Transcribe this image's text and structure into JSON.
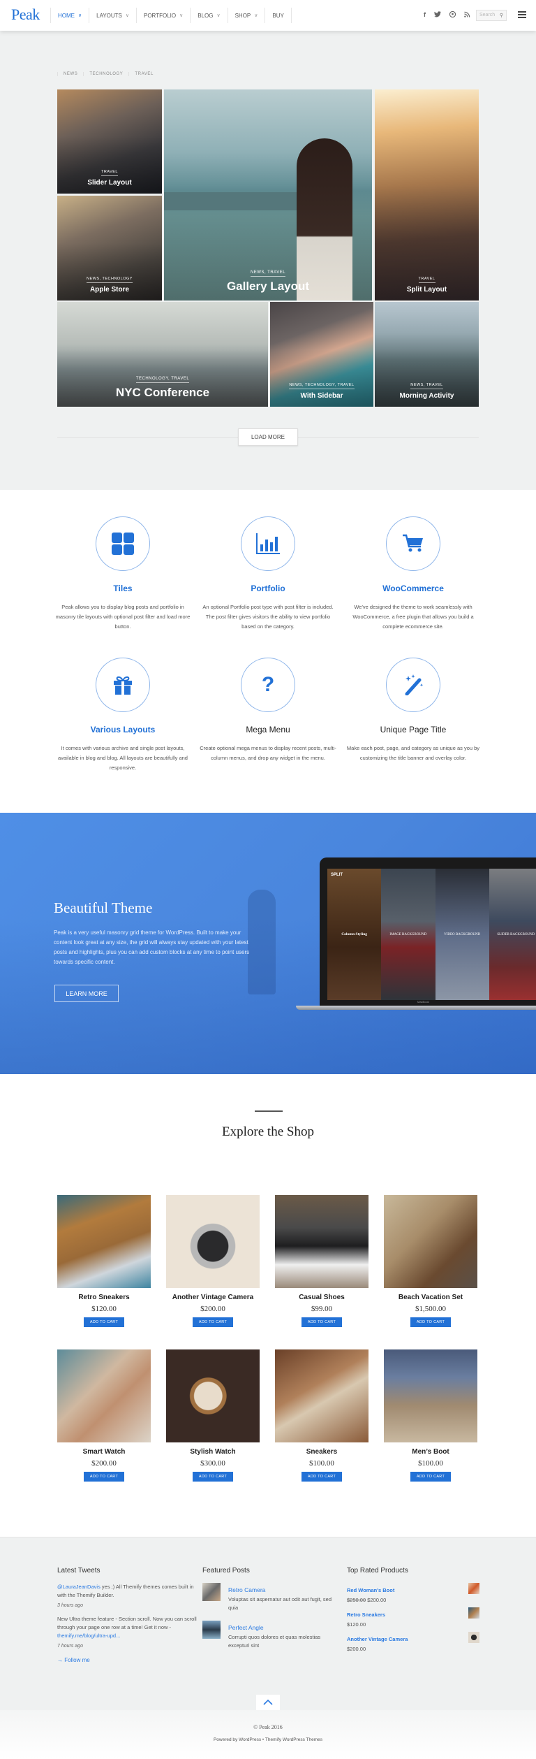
{
  "header": {
    "logo": "Peak",
    "nav": [
      {
        "label": "HOME",
        "dropdown": true,
        "active": true
      },
      {
        "label": "LAYOUTS",
        "dropdown": true
      },
      {
        "label": "PORTFOLIO",
        "dropdown": true
      },
      {
        "label": "BLOG",
        "dropdown": true
      },
      {
        "label": "SHOP",
        "dropdown": true
      },
      {
        "label": "BUY",
        "dropdown": false
      }
    ],
    "social": [
      "facebook-icon",
      "twitter-icon",
      "pinterest-icon",
      "rss-icon"
    ],
    "search_placeholder": "Search"
  },
  "filter": [
    "NEWS",
    "TECHNOLOGY",
    "TRAVEL"
  ],
  "tiles": [
    {
      "category": "TRAVEL",
      "title": "Slider Layout"
    },
    {
      "category": "NEWS, TRAVEL",
      "title": "Gallery Layout"
    },
    {
      "category": "TRAVEL",
      "title": "Split Layout"
    },
    {
      "category": "NEWS, TECHNOLOGY",
      "title": "Apple Store"
    },
    {
      "category": "TECHNOLOGY, TRAVEL",
      "title": "NYC Conference"
    },
    {
      "category": "NEWS, TECHNOLOGY, TRAVEL",
      "title": "With Sidebar"
    },
    {
      "category": "NEWS, TRAVEL",
      "title": "Morning Activity"
    }
  ],
  "load_more": "LOAD MORE",
  "features": [
    {
      "icon": "tiles-icon",
      "title": "Tiles",
      "text": "Peak allows you to display blog posts and portfolio in masonry tile layouts with optional post filter and load more button."
    },
    {
      "icon": "bar-chart-icon",
      "title": "Portfolio",
      "text": "An optional Portfolio post type with post filter is included. The post filter gives visitors the ability to view portfolio based on the category."
    },
    {
      "icon": "cart-icon",
      "title": "WooCommerce",
      "text": "We've designed the theme to work seamlessly with WooCommerce, a free plugin that allows you build a complete ecommerce site."
    },
    {
      "icon": "gift-icon",
      "title": "Various Layouts",
      "text": "It comes with various archive and single post layouts, available in blog and blog. All layouts are beautifully and responsive."
    },
    {
      "icon": "question-icon",
      "title": "Mega Menu",
      "text": "Create optional mega menus to display recent posts, multi-column menus, and drop any widget in the menu."
    },
    {
      "icon": "magic-wand-icon",
      "title": "Unique Page Title",
      "text": "Make each post, page, and category as unique as you by customizing the title banner and overlay color."
    }
  ],
  "hero": {
    "title": "Beautiful Theme",
    "text": "Peak is a very useful masonry grid theme for WordPress. Built to make your content look great at any size, the grid will always stay updated with your latest posts and highlights, plus you can add custom blocks at any time to point users towards specific content.",
    "button": "LEARN MORE",
    "laptop": {
      "logo": "SPLIT",
      "panels": [
        "Column Styling",
        "IMAGE BACKGROUND",
        "VIDEO BACKGROUND",
        "SLIDER BACKGROUND"
      ],
      "brand": "MacBook"
    }
  },
  "shop": {
    "title": "Explore the Shop",
    "add_to_cart": "ADD TO CART",
    "products": [
      {
        "name": "Retro Sneakers",
        "price": "$120.00"
      },
      {
        "name": "Another Vintage Camera",
        "price": "$200.00"
      },
      {
        "name": "Casual Shoes",
        "price": "$99.00"
      },
      {
        "name": "Beach Vacation Set",
        "price": "$1,500.00"
      },
      {
        "name": "Smart Watch",
        "price": "$200.00"
      },
      {
        "name": "Stylish Watch",
        "price": "$300.00"
      },
      {
        "name": "Sneakers",
        "price": "$100.00"
      },
      {
        "name": "Men’s Boot",
        "price": "$100.00"
      }
    ]
  },
  "footer": {
    "tweets": {
      "title": "Latest Tweets",
      "items": [
        {
          "mention": "@LauraJeanDavis",
          "text": " yes ;) All Themify themes comes built in with the Themify Builder.",
          "time": "3 hours ago"
        },
        {
          "text": "New Ultra theme feature - Section scroll. Now you can scroll through your page one row at a time! Get it now - ",
          "link": "themify.me/blog/ultra-upd...",
          "time": "7 hours ago"
        }
      ],
      "follow": "→ Follow me"
    },
    "featured": {
      "title": "Featured Posts",
      "items": [
        {
          "title": "Retro Camera",
          "text": "Voluptas sit aspernatur aut odit aut fugit, sed quia"
        },
        {
          "title": "Perfect Angle",
          "text": "Corrupti quos dolores et quas molestias excepturi sint"
        }
      ]
    },
    "top_rated": {
      "title": "Top Rated Products",
      "items": [
        {
          "name": "Red Woman's Boot",
          "old_price": "$250.00",
          "price": "$200.00"
        },
        {
          "name": "Retro Sneakers",
          "price": "$120.00"
        },
        {
          "name": "Another Vintage Camera",
          "price": "$200.00"
        }
      ]
    },
    "back_to_top": "^",
    "copyright": "© Peak 2016",
    "powered": "Powered by WordPress • Themify WordPress Themes"
  }
}
